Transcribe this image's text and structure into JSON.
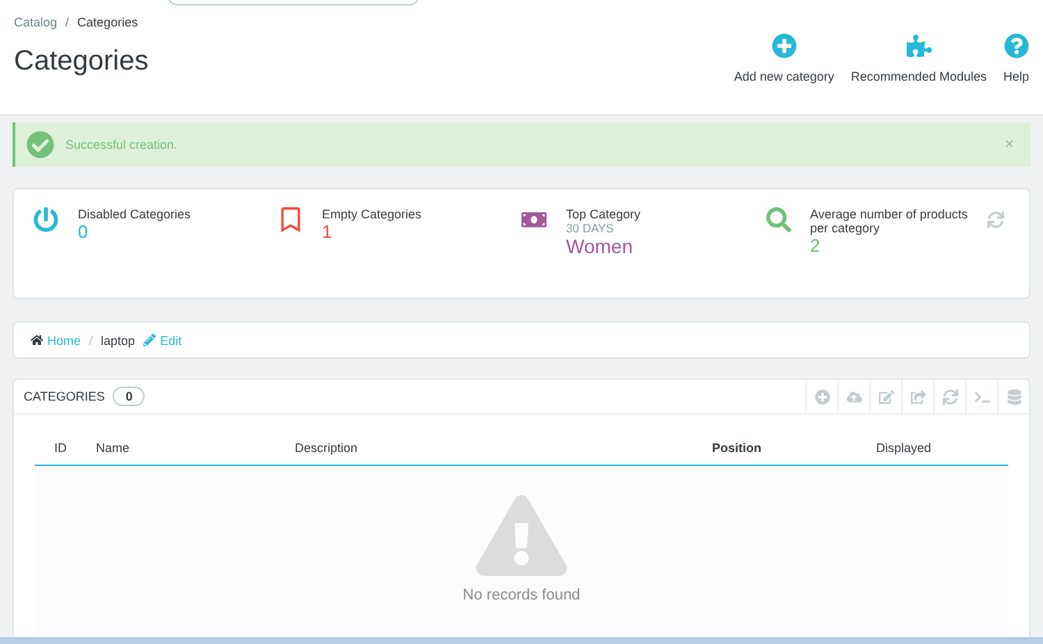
{
  "breadcrumb": [
    "Catalog",
    "Categories"
  ],
  "separator": "/",
  "title": "Categories",
  "actions": [
    {
      "label": "Add new category"
    },
    {
      "label": "Recommended Modules"
    },
    {
      "label": "Help"
    }
  ],
  "alert": {
    "text": "Successful creation.",
    "close": "×"
  },
  "stats": [
    {
      "label": "Disabled Categories",
      "value": "0",
      "color": "#25b9d7"
    },
    {
      "label": "Empty Categories",
      "value": "1",
      "color": "#f54c3e"
    },
    {
      "label": "Top Category",
      "sub": "30 DAYS",
      "value": "Women",
      "color": "#a15799"
    },
    {
      "label": "Average number of products per category",
      "value": "2",
      "color": "#72c279"
    }
  ],
  "path": {
    "home": "Home",
    "separator": "/",
    "current": "laptop",
    "edit": "Edit"
  },
  "panel": {
    "title": "CATEGORIES",
    "count": "0",
    "empty": "No records found",
    "columns": [
      {
        "label": "ID",
        "active": false
      },
      {
        "label": "Name",
        "active": false
      },
      {
        "label": "Description",
        "active": false
      },
      {
        "label": "Position",
        "active": true
      },
      {
        "label": "Displayed",
        "active": false
      }
    ]
  }
}
